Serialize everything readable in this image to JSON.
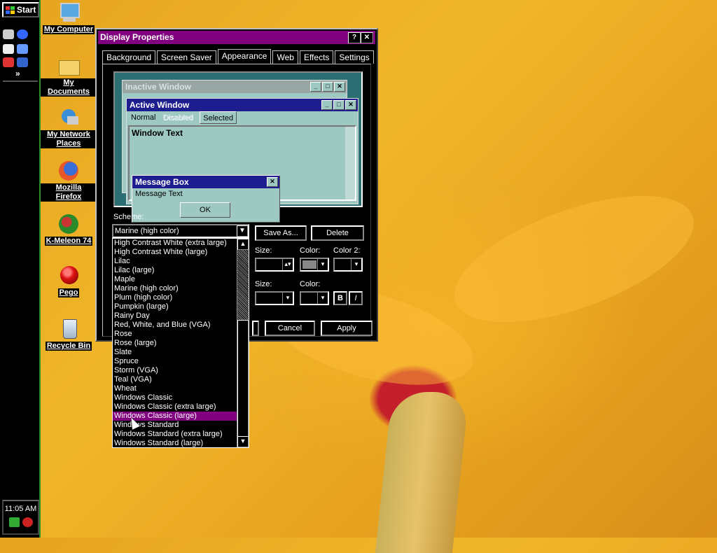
{
  "taskbar": {
    "start_label": "Start",
    "quick_more": "»",
    "clock": "11:05 AM"
  },
  "desktop_icons": [
    {
      "label": "My Computer",
      "icon": "computer-icon"
    },
    {
      "label": "My Documents",
      "icon": "folder-documents-icon"
    },
    {
      "label": "My Network Places",
      "icon": "network-icon"
    },
    {
      "label": "Mozilla Firefox",
      "icon": "firefox-icon"
    },
    {
      "label": "K-Meleon 74",
      "icon": "kmeleon-icon"
    },
    {
      "label": "Pego",
      "icon": "pego-icon"
    },
    {
      "label": "Recycle Bin",
      "icon": "recycle-bin-icon"
    }
  ],
  "dialog": {
    "title": "Display Properties",
    "help_btn": "?",
    "close_btn": "✕",
    "tabs": [
      "Background",
      "Screen Saver",
      "Appearance",
      "Web",
      "Effects",
      "Settings"
    ],
    "active_tab": "Appearance",
    "preview": {
      "inactive_title": "Inactive Window",
      "active_title": "Active Window",
      "menu_normal": "Normal",
      "menu_disabled": "Disabled",
      "menu_selected": "Selected",
      "window_text": "Window Text",
      "msg_title": "Message Box",
      "msg_text": "Message Text",
      "msg_ok": "OK"
    },
    "scheme_label": "Scheme:",
    "scheme_value": "Marine (high color)",
    "save_as": "Save As...",
    "delete": "Delete",
    "size_label": "Size:",
    "color_label": "Color:",
    "color2_label": "Color 2:",
    "size_label2": "Size:",
    "color_label2": "Color:",
    "bold_btn": "B",
    "italic_btn": "I",
    "cancel": "Cancel",
    "apply": "Apply"
  },
  "scheme_options": [
    "High Contrast White (extra large)",
    "High Contrast White (large)",
    "Lilac",
    "Lilac (large)",
    "Maple",
    "Marine (high color)",
    "Plum (high color)",
    "Pumpkin (large)",
    "Rainy Day",
    "Red, White, and Blue (VGA)",
    "Rose",
    "Rose (large)",
    "Slate",
    "Spruce",
    "Storm (VGA)",
    "Teal (VGA)",
    "Wheat",
    "Windows Classic",
    "Windows Classic (extra large)",
    "Windows Classic (large)",
    "Windows Standard",
    "Windows Standard (extra large)",
    "Windows Standard (large)"
  ],
  "highlighted_option": "Windows Classic (large)",
  "colors": {
    "title_active": "#800080",
    "highlight": "#800080",
    "preview_bg": "#2c6f73",
    "preview_window": "#9ec9c3",
    "preview_active_title": "#1d1d8f"
  }
}
